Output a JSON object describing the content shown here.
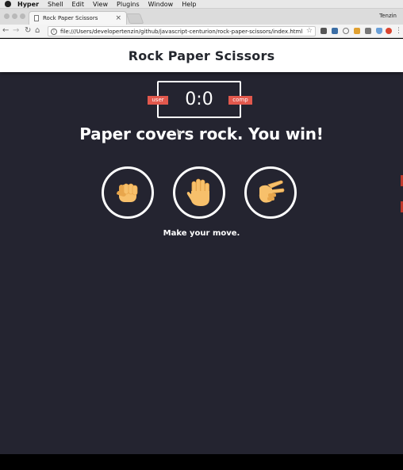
{
  "menubar": {
    "app": "Hyper",
    "items": [
      "Shell",
      "Edit",
      "View",
      "Plugins",
      "Window",
      "Help"
    ]
  },
  "browser": {
    "tab_title": "Rock Paper Scissors",
    "tab_close": "×",
    "user_name": "Tenzin",
    "url": "file:///Users/developertenzin/github/javascript-centurion/rock-paper-scissors/index.html",
    "back": "←",
    "forward": "→",
    "reload": "↻",
    "home": "⌂",
    "info": "i",
    "star": "☆"
  },
  "page": {
    "title": "Rock Paper Scissors",
    "score": "0:0",
    "user_badge": "user",
    "comp_badge": "comp",
    "result_message": "Paper covers rock. You win!",
    "prompt": "Make your move.",
    "choices": [
      {
        "name": "rock",
        "icon": "fist-icon"
      },
      {
        "name": "paper",
        "icon": "open-hand-icon"
      },
      {
        "name": "scissors",
        "icon": "scissors-hand-icon"
      }
    ]
  },
  "colors": {
    "page_bg": "#242430",
    "badge": "#e2584d",
    "skin": "#f7c06b",
    "skin_shade": "#e8a64c"
  }
}
